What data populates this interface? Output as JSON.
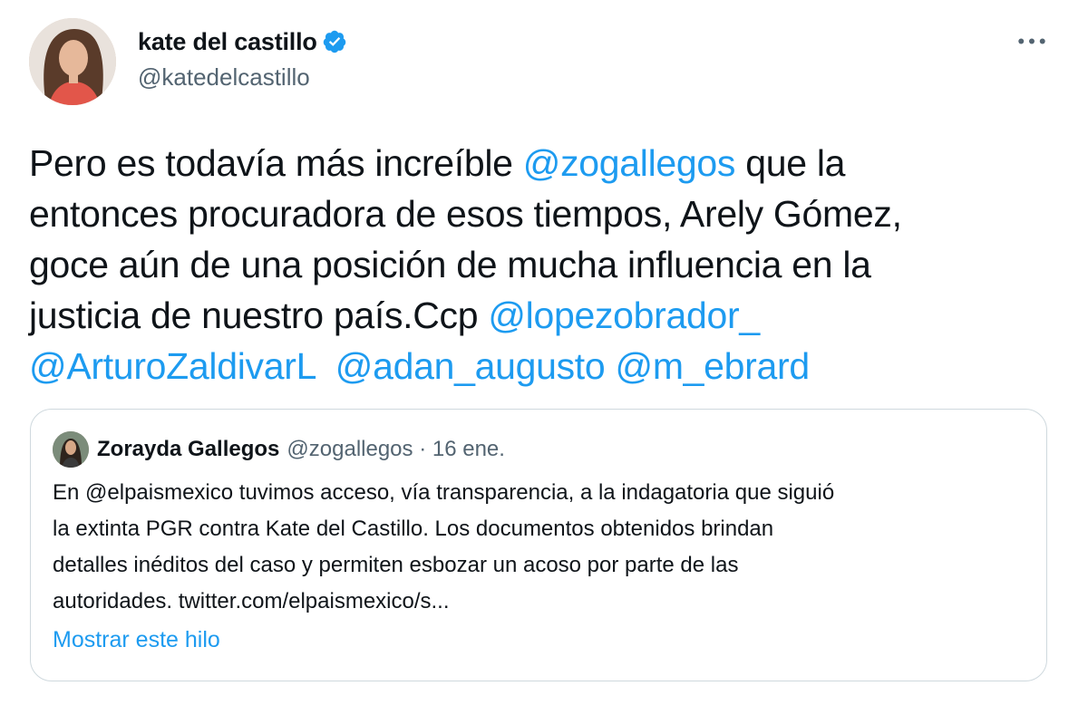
{
  "author": {
    "display_name": "kate del castillo",
    "handle": "@katedelcastillo"
  },
  "more_icon": "more-horizontal-icon",
  "tweet": {
    "lines": [
      [
        "Pero es todavía más increíble ",
        "@zogallegos",
        " que la"
      ],
      [
        "entonces procuradora de esos tiempos, Arely Gómez,"
      ],
      [
        "goce aún de una posición de mucha influencia en la"
      ],
      [
        "justicia de nuestro país.Ccp ",
        "@lopezobrador_"
      ],
      [
        "@ArturoZaldivarL",
        "  ",
        "@adan_augusto",
        " ",
        "@m_ebrard"
      ]
    ]
  },
  "quoted": {
    "display_name": "Zorayda Gallegos",
    "handle": "@zogallegos",
    "separator": "·",
    "date": "16 ene.",
    "body_lines": [
      "En @elpaismexico tuvimos acceso, vía transparencia, a la indagatoria que siguió",
      "la extinta PGR contra Kate del Castillo. Los documentos obtenidos brindan",
      "detalles inéditos del caso y permiten esbozar un acoso por parte de las",
      "autoridades. twitter.com/elpaismexico/s..."
    ],
    "show_thread": "Mostrar este hilo"
  },
  "colors": {
    "link": "#1d9bf0",
    "text": "#0f1419",
    "secondary": "#536471",
    "border": "#cfd9de"
  }
}
